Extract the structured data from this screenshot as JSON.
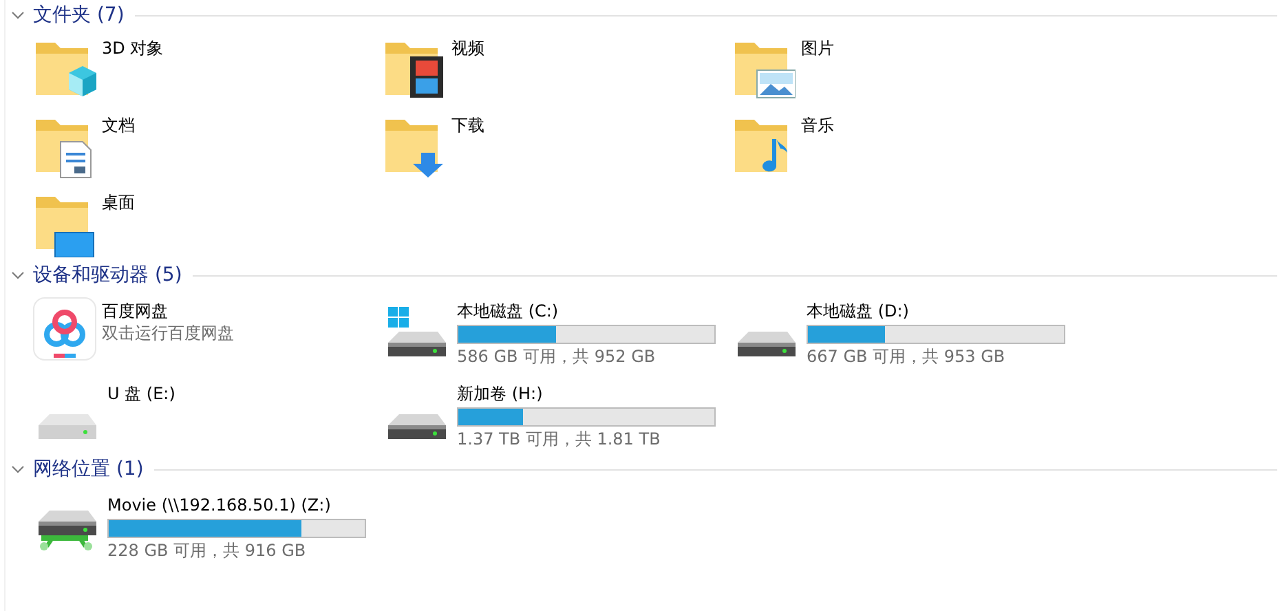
{
  "sections": [
    {
      "title": "文件夹 (7)",
      "expanded": true,
      "items": [
        {
          "kind": "cube",
          "name": "3D 对象"
        },
        {
          "kind": "film",
          "name": "视频"
        },
        {
          "kind": "photo",
          "name": "图片"
        },
        {
          "kind": "document",
          "name": "文档"
        },
        {
          "kind": "download",
          "name": "下载"
        },
        {
          "kind": "music",
          "name": "音乐"
        },
        {
          "kind": "desktop",
          "name": "桌面"
        }
      ]
    },
    {
      "title": "设备和驱动器 (5)",
      "expanded": true,
      "items": [
        {
          "kind": "app",
          "name": "百度网盘",
          "subtitle": "双击运行百度网盘"
        },
        {
          "kind": "system-disk",
          "name": "本地磁盘 (C:)",
          "level": 0.38,
          "space": "586 GB 可用，共 952 GB"
        },
        {
          "kind": "disk",
          "name": "本地磁盘 (D:)",
          "level": 0.3,
          "space": "667 GB 可用，共 953 GB"
        },
        {
          "kind": "removable",
          "name": "U 盘 (E:)"
        },
        {
          "kind": "disk",
          "name": "新加卷 (H:)",
          "level": 0.25,
          "space": "1.37 TB 可用，共 1.81 TB"
        }
      ]
    },
    {
      "title": "网络位置 (1)",
      "expanded": true,
      "items": [
        {
          "kind": "network",
          "name": "Movie (\\\\192.168.50.1) (Z:)",
          "level": 0.75,
          "space": "228 GB 可用，共 916 GB"
        }
      ]
    }
  ]
}
